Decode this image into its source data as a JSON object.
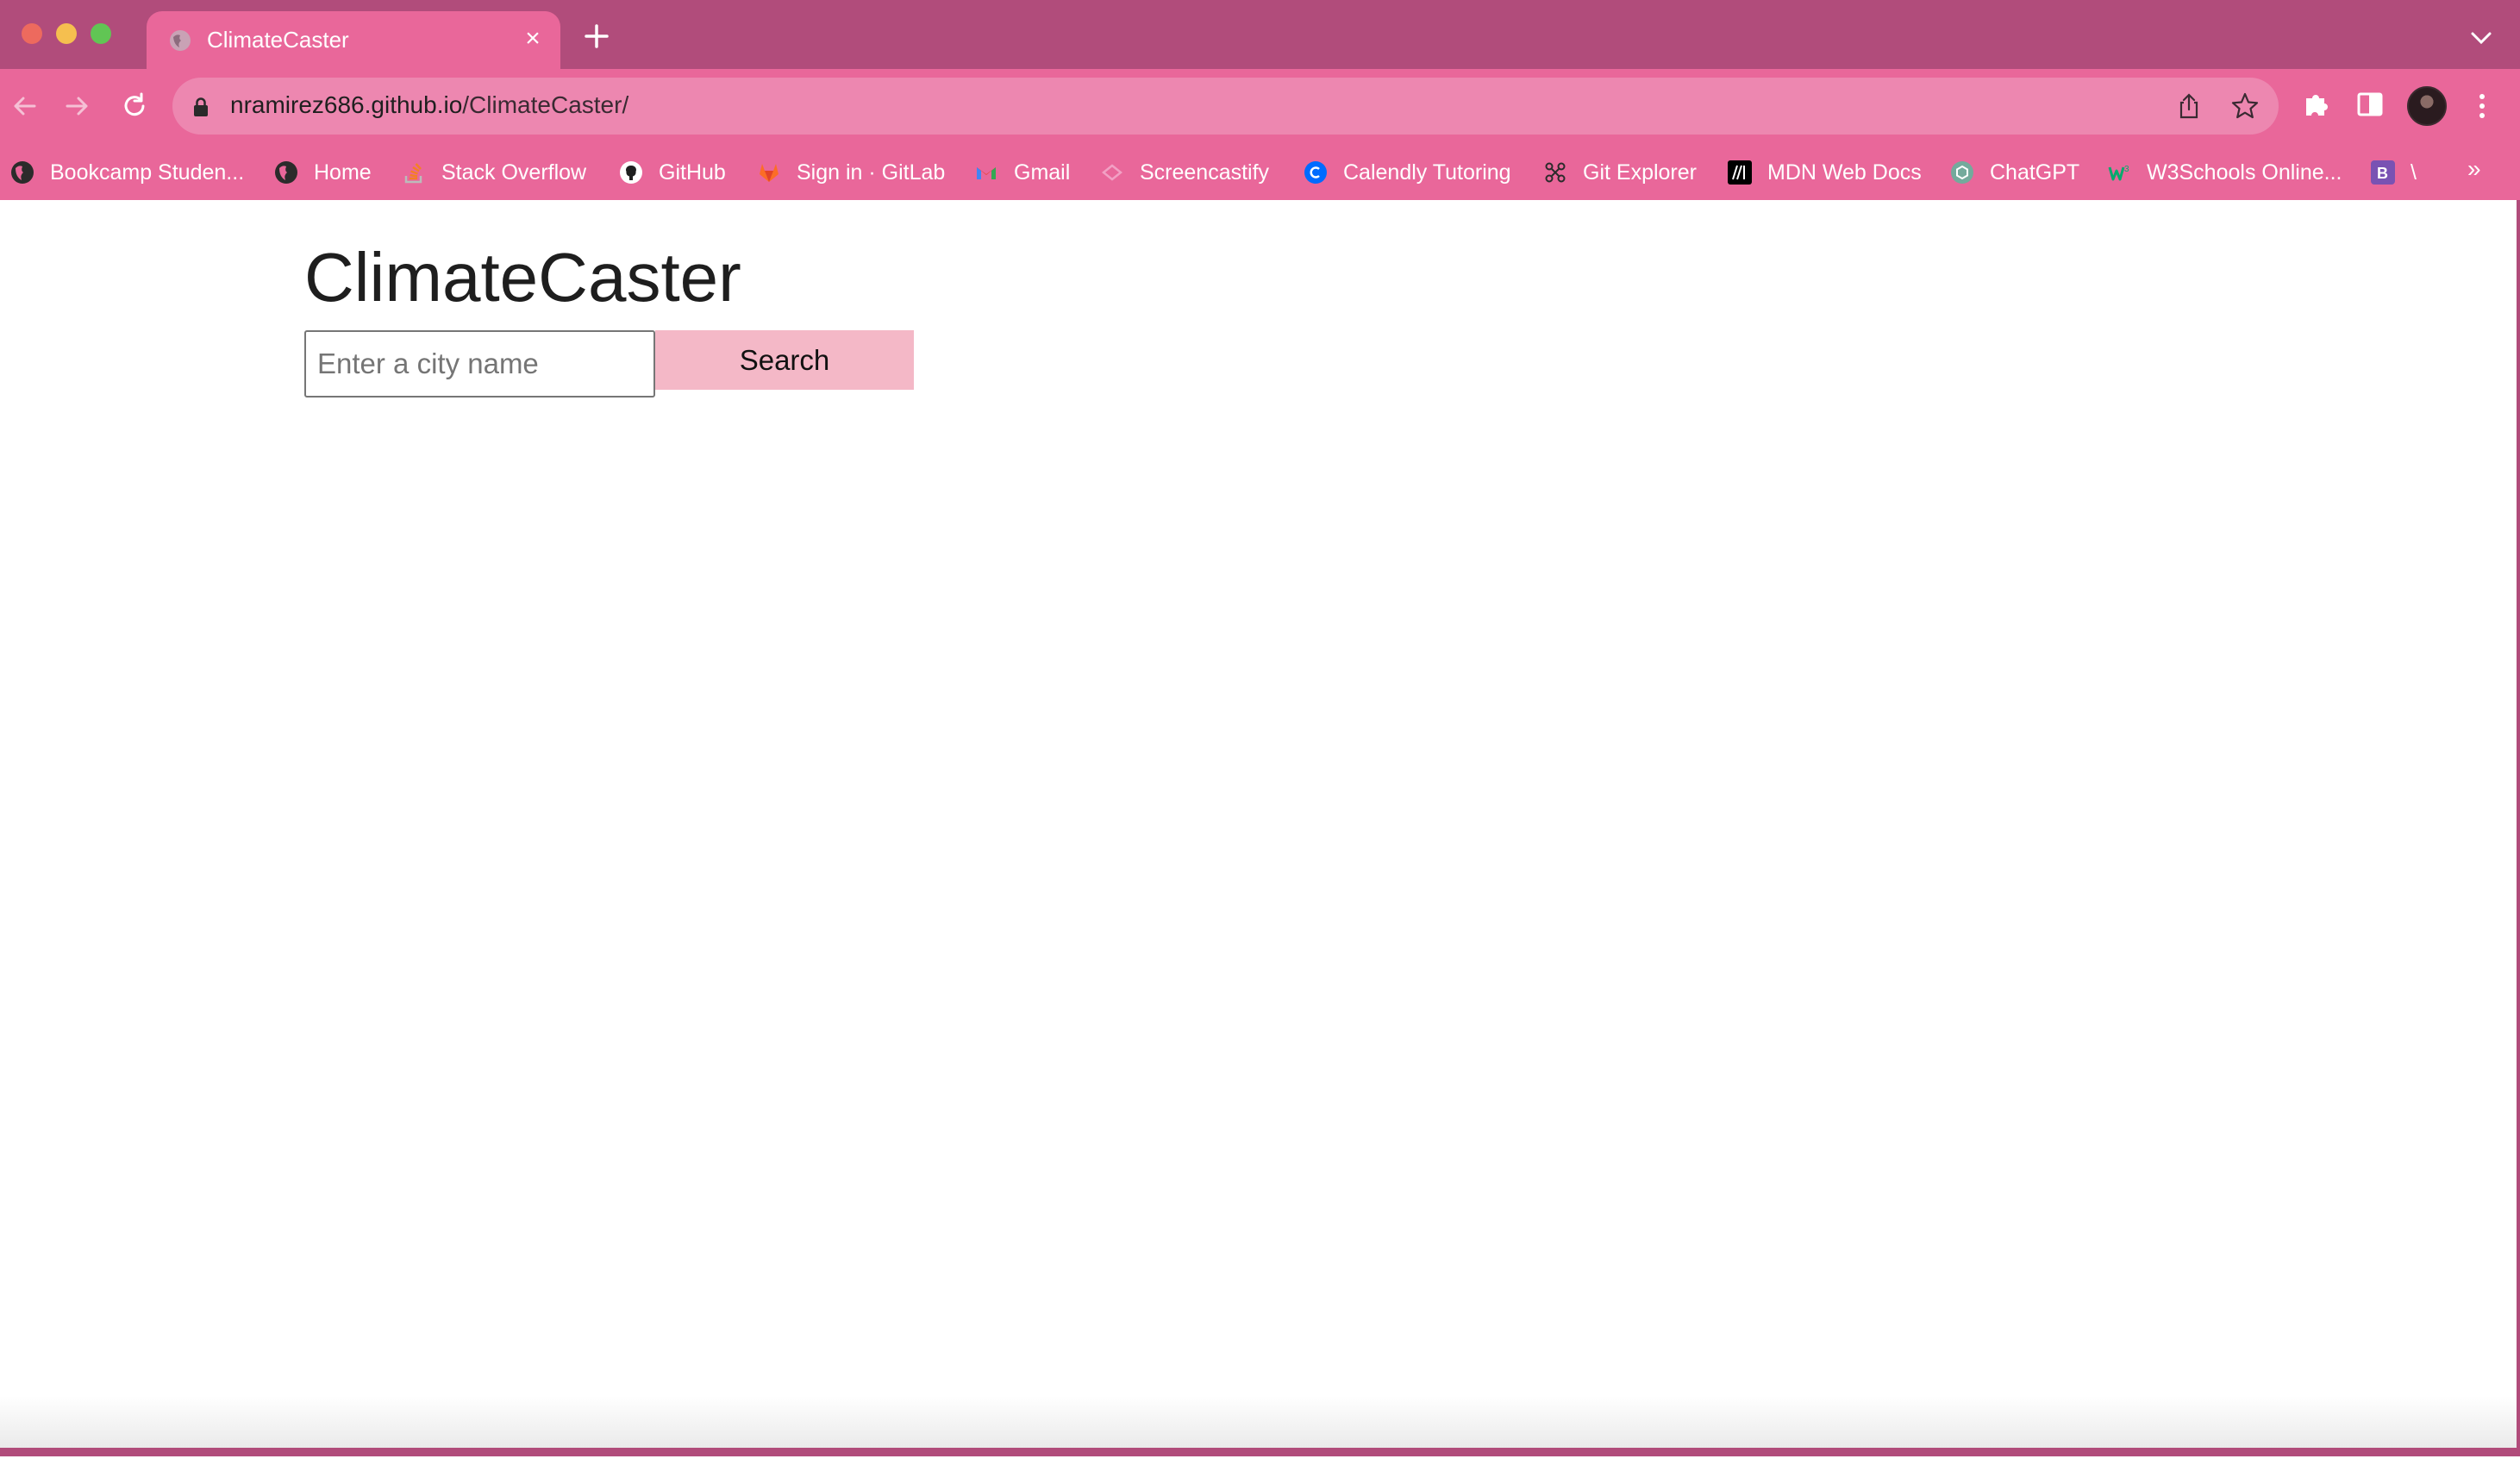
{
  "browser": {
    "tab": {
      "title": "ClimateCaster",
      "favicon": "globe-icon"
    },
    "address": {
      "host": "nramirez686.github.io",
      "path": "/ClimateCaster/"
    },
    "bookmarks": [
      {
        "label": "Bookcamp Studen...",
        "icon": "globe-icon"
      },
      {
        "label": "Home",
        "icon": "globe-icon"
      },
      {
        "label": "Stack Overflow",
        "icon": "stackoverflow-icon"
      },
      {
        "label": "GitHub",
        "icon": "github-icon"
      },
      {
        "label": "Sign in · GitLab",
        "icon": "gitlab-icon"
      },
      {
        "label": "Gmail",
        "icon": "gmail-icon"
      },
      {
        "label": "Screencastify",
        "icon": "screencastify-icon"
      },
      {
        "label": "Calendly Tutoring",
        "icon": "calendly-icon"
      },
      {
        "label": "Git Explorer",
        "icon": "git-explorer-icon"
      },
      {
        "label": "MDN Web Docs",
        "icon": "mdn-icon"
      },
      {
        "label": "ChatGPT",
        "icon": "chatgpt-icon"
      },
      {
        "label": "W3Schools Online...",
        "icon": "w3schools-icon"
      },
      {
        "label": "\\",
        "icon": "bootstrap-icon"
      }
    ],
    "bookmarks_overflow": "»",
    "colors": {
      "frame": "#b14c7b",
      "toolbar": "#e9679a",
      "omnibox": "#ed87b0"
    }
  },
  "page": {
    "title": "ClimateCaster",
    "search": {
      "placeholder": "Enter a city name",
      "value": "",
      "button_label": "Search"
    },
    "colors": {
      "button": "#f4b8c7"
    }
  }
}
